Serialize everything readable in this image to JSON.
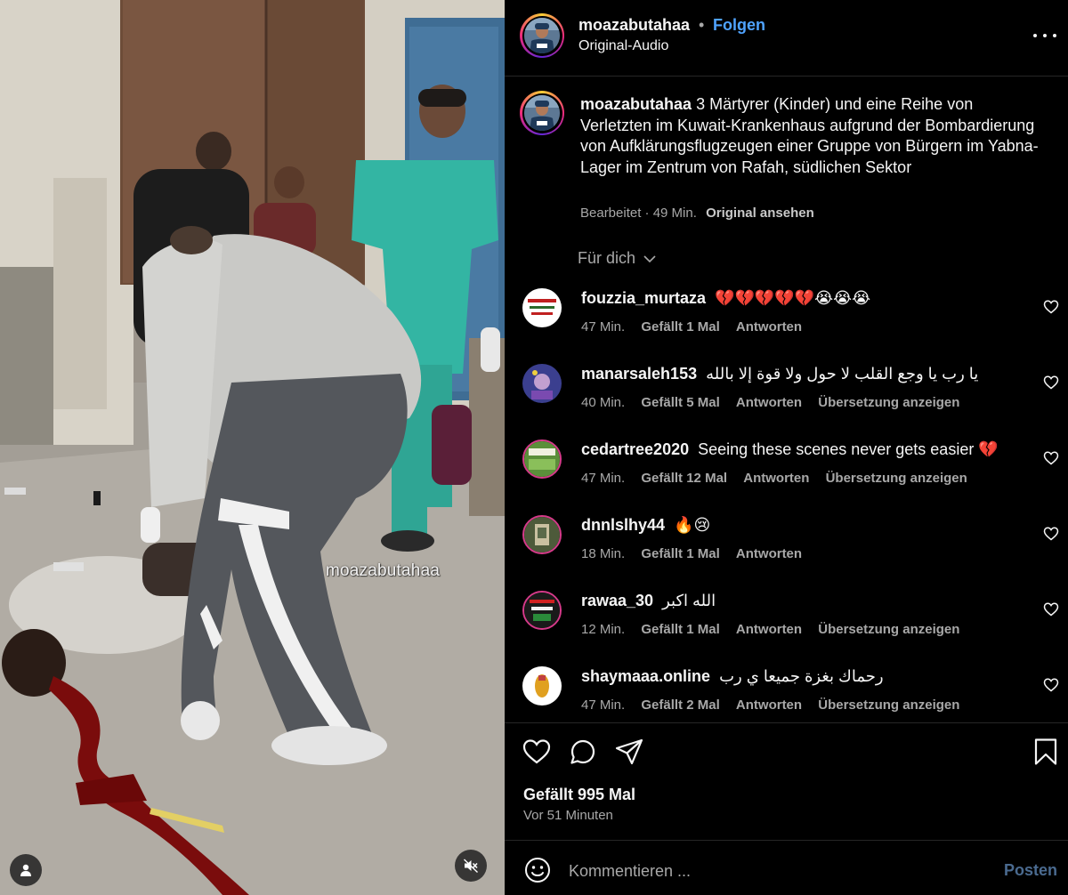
{
  "media": {
    "watermark": "moazabutahaa",
    "user_tag_icon": "person-icon",
    "mute_icon": "speaker-muted-icon"
  },
  "header": {
    "username": "moazabutahaa",
    "separator": "•",
    "follow_label": "Folgen",
    "audio_label": "Original-Audio",
    "more_icon": "more-horizontal-icon"
  },
  "caption": {
    "username": "moazabutahaa",
    "text": "3 Märtyrer (Kinder) und eine Reihe von Verletzten im Kuwait-Krankenhaus aufgrund der Bombardierung von Aufklärungsflugzeugen einer Gruppe von Bürgern im Yabna-Lager im Zentrum von Rafah, südlichen Sektor",
    "meta": "Bearbeitet · 49 Min.",
    "see_original": "Original ansehen"
  },
  "sort_label": "Für dich",
  "comments": [
    {
      "user": "fouzzia_murtaza",
      "text": "💔💔💔💔💔😭😭😭",
      "time": "47 Min.",
      "likes": "Gefällt 1 Mal",
      "reply": "Antworten",
      "translate": "",
      "avatar_color": "#ffffff"
    },
    {
      "user": "manarsaleh153",
      "text": "يا رب يا وجع القلب لا حول ولا قوة إلا بالله",
      "time": "40 Min.",
      "likes": "Gefällt 5 Mal",
      "reply": "Antworten",
      "translate": "Übersetzung anzeigen",
      "avatar_color": "#3b3f8f"
    },
    {
      "user": "cedartree2020",
      "text": "Seeing these scenes never gets easier 💔",
      "time": "47 Min.",
      "likes": "Gefällt 12 Mal",
      "reply": "Antworten",
      "translate": "Übersetzung anzeigen",
      "avatar_color": "#5b8f3a"
    },
    {
      "user": "dnnlslhy44",
      "text": "🔥😢",
      "time": "18 Min.",
      "likes": "Gefällt 1 Mal",
      "reply": "Antworten",
      "translate": "",
      "avatar_color": "#4d5a3a"
    },
    {
      "user": "rawaa_30",
      "text": "الله اكبر",
      "time": "12 Min.",
      "likes": "Gefällt 1 Mal",
      "reply": "Antworten",
      "translate": "Übersetzung anzeigen",
      "avatar_color": "#1a1a1a"
    },
    {
      "user": "shaymaaa.online",
      "text": "رحماك بغزة جميعا ي رب",
      "time": "47 Min.",
      "likes": "Gefällt 2 Mal",
      "reply": "Antworten",
      "translate": "Übersetzung anzeigen",
      "avatar_color": "#ffffff"
    }
  ],
  "actions": {
    "like_icon": "heart-icon",
    "comment_icon": "comment-icon",
    "share_icon": "paper-plane-icon",
    "save_icon": "bookmark-icon"
  },
  "likes_label": "Gefällt 995 Mal",
  "posted_time": "Vor 51 Minuten",
  "comment_box": {
    "placeholder": "Kommentieren ...",
    "post_label": "Posten",
    "emoji_icon": "smiley-icon"
  }
}
